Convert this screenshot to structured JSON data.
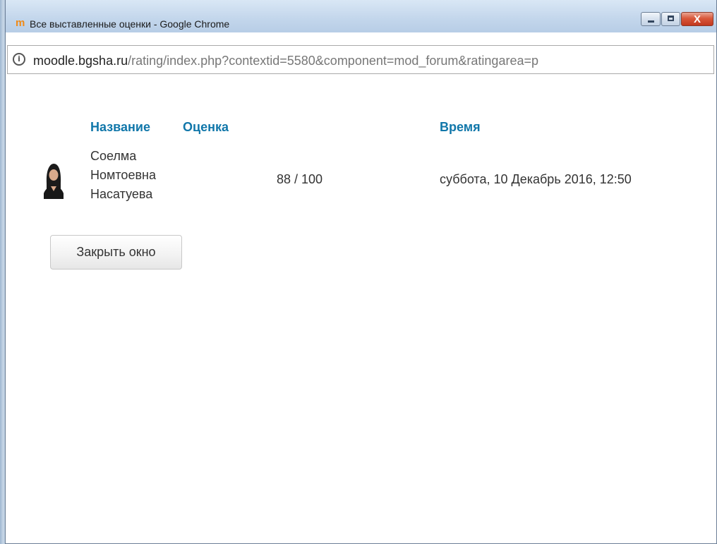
{
  "window": {
    "title": "Все выставленные оценки - Google Chrome",
    "app_logo": "m",
    "controls": {
      "minimize_icon": "minimize-icon",
      "maximize_icon": "maximize-icon",
      "close_label": "X"
    }
  },
  "address_bar": {
    "info_glyph": "i",
    "host": "moodle.bgsha.ru",
    "path": "/rating/index.php?contextid=5580&component=mod_forum&ratingarea=p"
  },
  "ratings_table": {
    "headers": {
      "name": "Название",
      "rating": "Оценка",
      "time": "Время"
    },
    "rows": [
      {
        "name_lines": [
          "Соелма",
          "Номтоевна",
          "Насатуева"
        ],
        "rating": "88 / 100",
        "time": "суббота, 10 Декабрь 2016, 12:50"
      }
    ]
  },
  "close_button": "Закрыть окно",
  "colors": {
    "link": "#1177aa",
    "text": "#333333",
    "moodle_orange": "#f08a16"
  }
}
